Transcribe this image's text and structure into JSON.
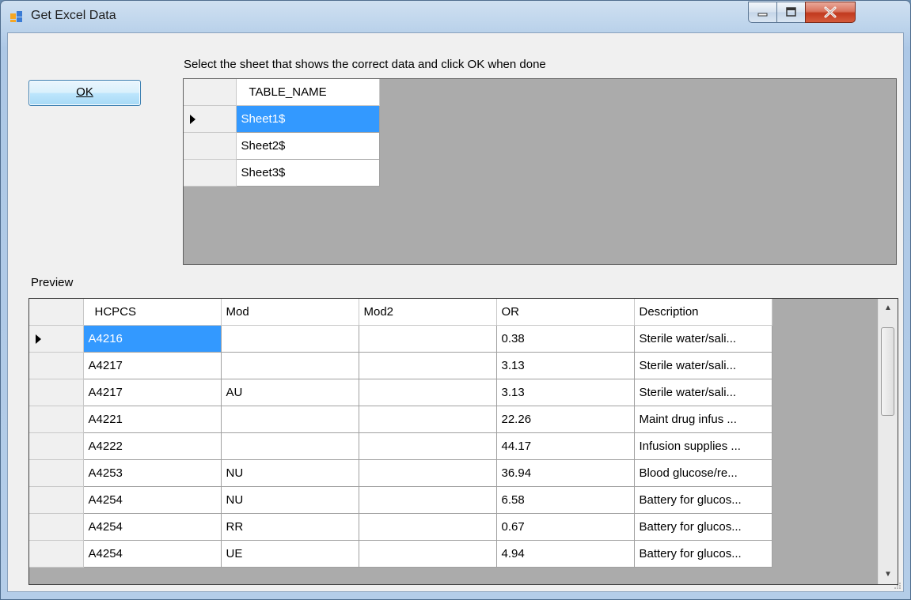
{
  "window": {
    "title": "Get Excel Data"
  },
  "ok_button": {
    "label": "OK"
  },
  "instruction": "Select the sheet that shows the correct data and click OK when done",
  "sheets_grid": {
    "column": "TABLE_NAME",
    "rows": [
      "Sheet1$",
      "Sheet2$",
      "Sheet3$"
    ],
    "selected_index": 0
  },
  "preview_label": "Preview",
  "preview_grid": {
    "columns": [
      "HCPCS",
      "Mod",
      "Mod2",
      "OR",
      "Description"
    ],
    "rows": [
      [
        "A4216",
        "",
        "",
        "0.38",
        "Sterile water/sali..."
      ],
      [
        "A4217",
        "",
        "",
        "3.13",
        "Sterile water/sali..."
      ],
      [
        "A4217",
        "AU",
        "",
        "3.13",
        "Sterile water/sali..."
      ],
      [
        "A4221",
        "",
        "",
        "22.26",
        "Maint drug infus ..."
      ],
      [
        "A4222",
        "",
        "",
        "44.17",
        "Infusion supplies ..."
      ],
      [
        "A4253",
        "NU",
        "",
        "36.94",
        "Blood glucose/re..."
      ],
      [
        "A4254",
        "NU",
        "",
        "6.58",
        "Battery for glucos..."
      ],
      [
        "A4254",
        "RR",
        "",
        "0.67",
        "Battery for glucos..."
      ],
      [
        "A4254",
        "UE",
        "",
        "4.94",
        "Battery for glucos..."
      ]
    ],
    "selected_row": 0
  },
  "icons": {
    "app": "app-window-icon",
    "minimize": "minimize-icon",
    "maximize": "maximize-icon",
    "close": "close-icon"
  }
}
